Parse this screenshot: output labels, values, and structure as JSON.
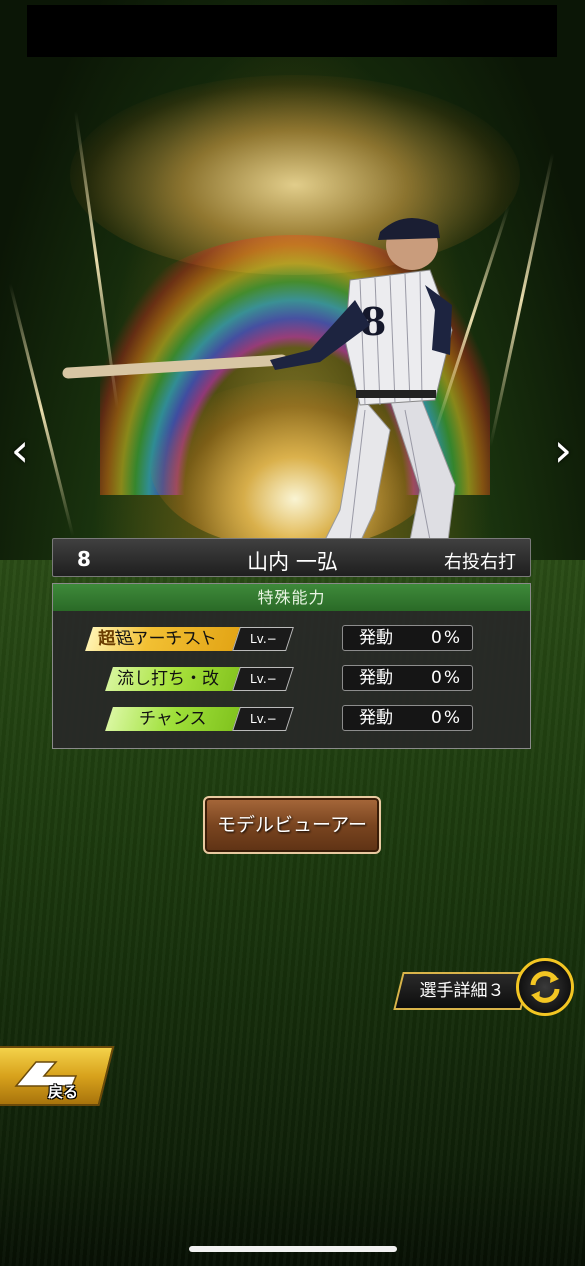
{
  "nav": {
    "prev_icon": "‹",
    "next_icon": "›"
  },
  "player": {
    "number": "8",
    "name": "山内 一弘",
    "handedness": "右投右打",
    "jersey_display": "8"
  },
  "abilities": {
    "header": "特殊能力",
    "items": [
      {
        "name": "超アーチスト",
        "badge": "超",
        "level": "Lv.−",
        "activation_label": "発動",
        "activation_value": "0%",
        "color": "#f2c033"
      },
      {
        "name": "流し打ち・改",
        "level": "Lv.−",
        "activation_label": "発動",
        "activation_value": "0%",
        "color": "#a8e23c"
      },
      {
        "name": "チャンス",
        "level": "Lv.−",
        "activation_label": "発動",
        "activation_value": "0%",
        "color": "#9fe03a"
      }
    ]
  },
  "buttons": {
    "model_viewer": "モデルビューアー",
    "player_detail": "選手詳細３",
    "back": "戻る"
  },
  "colors": {
    "ability_header": "#2f7a2c",
    "gold": "#f3c623"
  }
}
